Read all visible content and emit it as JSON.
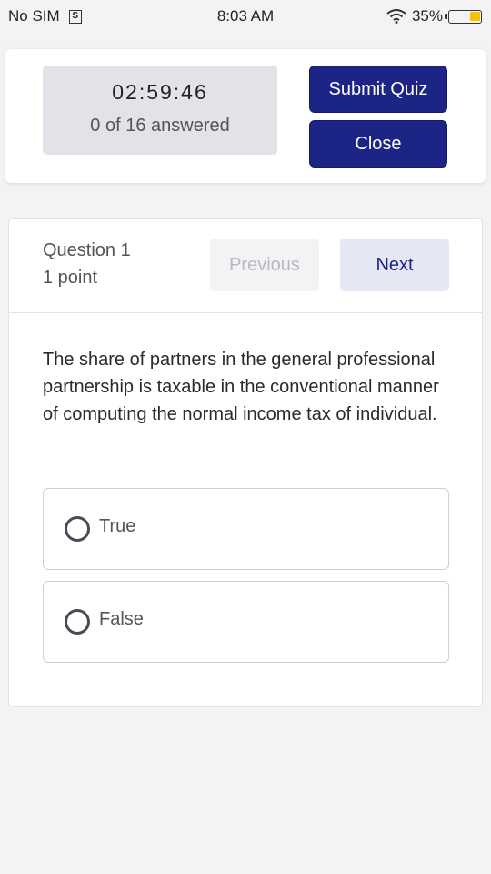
{
  "status_bar": {
    "carrier": "No SIM",
    "time": "8:03 AM",
    "battery_percent": "35%",
    "battery_level": 0.35,
    "icons": [
      "sim-icon",
      "wifi-icon",
      "battery-icon"
    ]
  },
  "quiz_header": {
    "timer": "02:59:46",
    "answered": "0 of 16 answered",
    "submit_label": "Submit Quiz",
    "close_label": "Close"
  },
  "question": {
    "title": "Question 1",
    "points": "1 point",
    "previous_label": "Previous",
    "next_label": "Next",
    "text": "The share of partners in the general professional partnership is taxable in the conventional manner of computing the normal income tax of individual.",
    "options": [
      {
        "label": "True"
      },
      {
        "label": "False"
      }
    ]
  },
  "colors": {
    "primary": "#1c2585",
    "battery": "#f2c300",
    "background": "#f3f3f6"
  }
}
